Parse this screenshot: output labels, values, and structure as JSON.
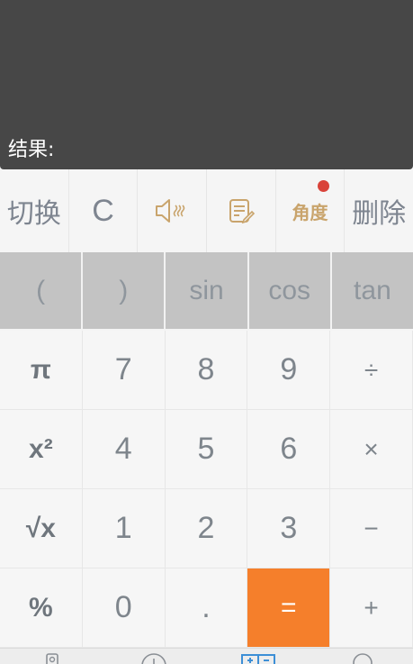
{
  "display": {
    "result_label": "结果:"
  },
  "toolbar": {
    "switch_label": "切换",
    "clear_label": "C",
    "sound_icon": "speaker-icon",
    "history_icon": "edit-list-icon",
    "angle_label": "角度",
    "delete_label": "删除"
  },
  "functions": [
    "(",
    ")",
    "sin",
    "cos",
    "tan"
  ],
  "keypad": [
    [
      "π",
      "7",
      "8",
      "9",
      "÷"
    ],
    [
      "x²",
      "4",
      "5",
      "6",
      "×"
    ],
    [
      "√x",
      "1",
      "2",
      "3",
      "−"
    ],
    [
      "%",
      "0",
      ".",
      "=",
      "+"
    ]
  ],
  "colors": {
    "display_bg": "#474747",
    "equals_bg": "#f57f2b",
    "function_row_bg": "#c3c3c3",
    "accent_gold": "#c9a46c",
    "notification_dot": "#d9433a"
  },
  "bottom_nav_icons": [
    "contacts-icon",
    "add-icon",
    "calculator-icon",
    "search-icon"
  ]
}
